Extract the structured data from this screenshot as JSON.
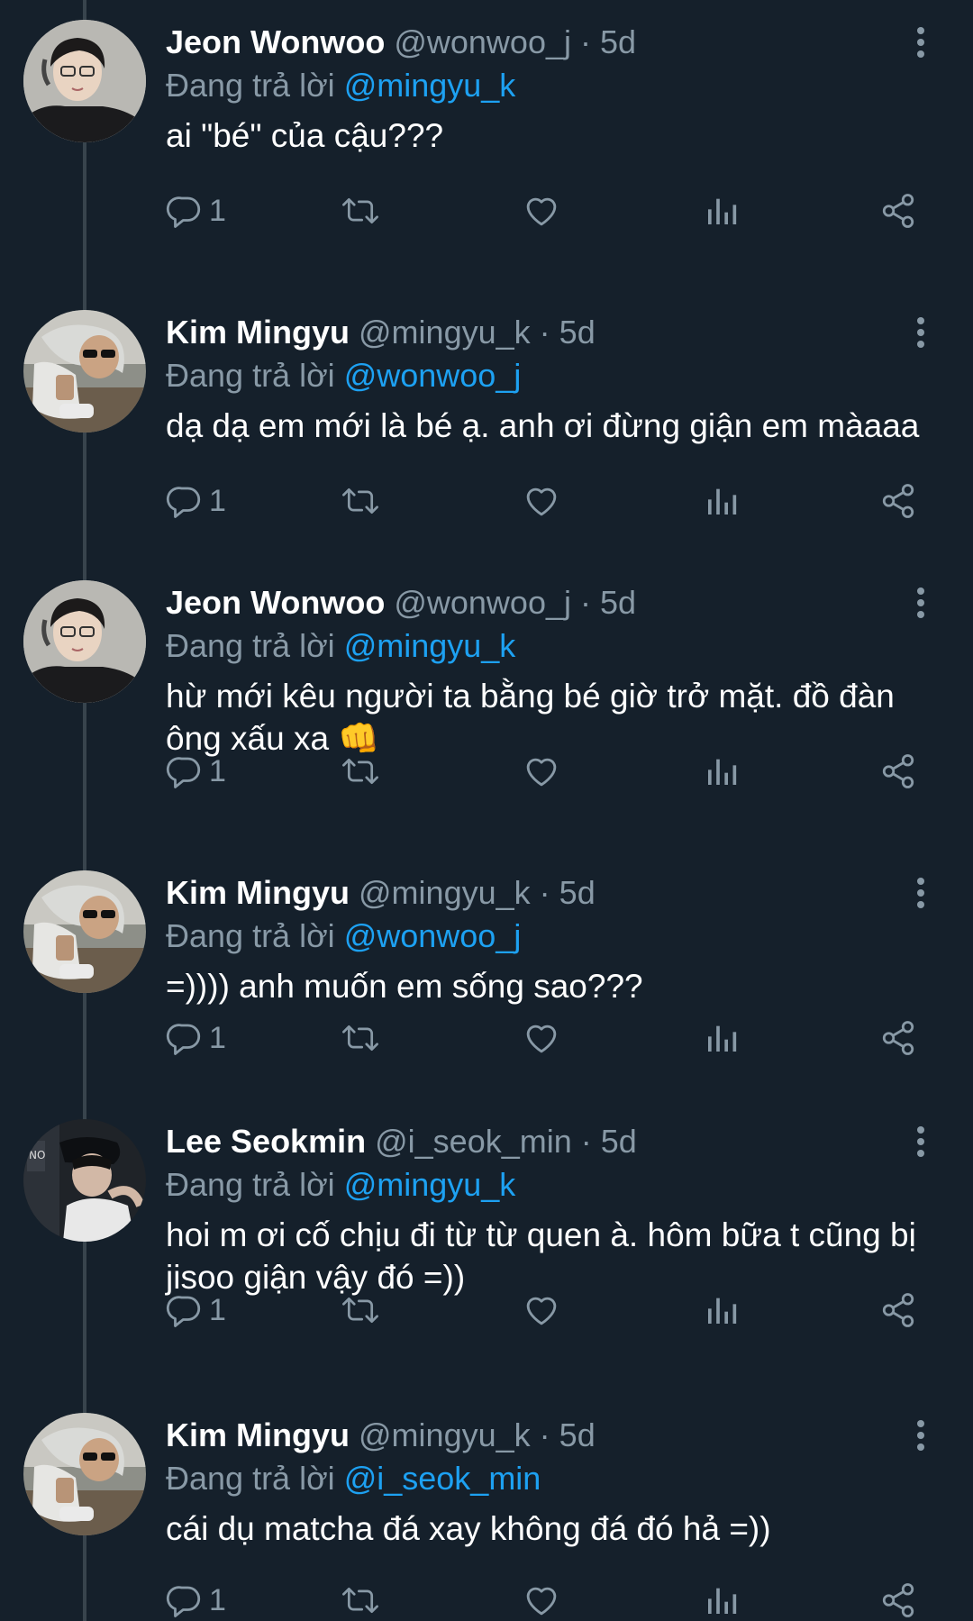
{
  "tweets": [
    {
      "name": "Jeon Wonwoo",
      "handle": "@wonwoo_j",
      "sep": "·",
      "time": "5d",
      "reply_prefix": "Đang trả lời ",
      "reply_to": "@mingyu_k",
      "text": "ai \"bé\" của cậu???",
      "reply_count": "1",
      "avatar": "wonwoo"
    },
    {
      "name": "Kim Mingyu",
      "handle": "@mingyu_k",
      "sep": "·",
      "time": "5d",
      "reply_prefix": "Đang trả lời ",
      "reply_to": "@wonwoo_j",
      "text": "dạ dạ em mới là bé ạ. anh ơi đừng giận em màaaa",
      "reply_count": "1",
      "avatar": "mingyu"
    },
    {
      "name": "Jeon Wonwoo",
      "handle": "@wonwoo_j",
      "sep": "·",
      "time": "5d",
      "reply_prefix": "Đang trả lời ",
      "reply_to": "@mingyu_k",
      "text": "hừ mới kêu người ta bằng bé giờ trở mặt. đồ đàn ông xấu xa 👊",
      "reply_count": "1",
      "avatar": "wonwoo"
    },
    {
      "name": "Kim Mingyu",
      "handle": "@mingyu_k",
      "sep": "·",
      "time": "5d",
      "reply_prefix": "Đang trả lời ",
      "reply_to": "@wonwoo_j",
      "text": "=)))) anh muốn em sống sao???",
      "reply_count": "1",
      "avatar": "mingyu"
    },
    {
      "name": "Lee Seokmin",
      "handle": "@i_seok_min",
      "sep": "·",
      "time": "5d",
      "reply_prefix": "Đang trả lời ",
      "reply_to": "@mingyu_k",
      "text": "hoi m ơi cố chịu đi từ từ quen à. hôm bữa t cũng bị jisoo giận vậy đó =))",
      "reply_count": "1",
      "avatar": "seokmin"
    },
    {
      "name": "Kim Mingyu",
      "handle": "@mingyu_k",
      "sep": "·",
      "time": "5d",
      "reply_prefix": "Đang trả lời ",
      "reply_to": "@i_seok_min",
      "text": "cái dụ matcha đá xay không đá đó hả =))",
      "reply_count": "1",
      "avatar": "mingyu"
    }
  ],
  "icons": {
    "reply": "reply-icon",
    "retweet": "retweet-icon",
    "like": "heart-icon",
    "analytics": "analytics-icon",
    "share": "share-icon",
    "more": "more-vertical-icon"
  },
  "colors": {
    "background": "#15202b",
    "muted": "#8899a6",
    "accent": "#1da1f2",
    "thread_line": "#38444d"
  }
}
